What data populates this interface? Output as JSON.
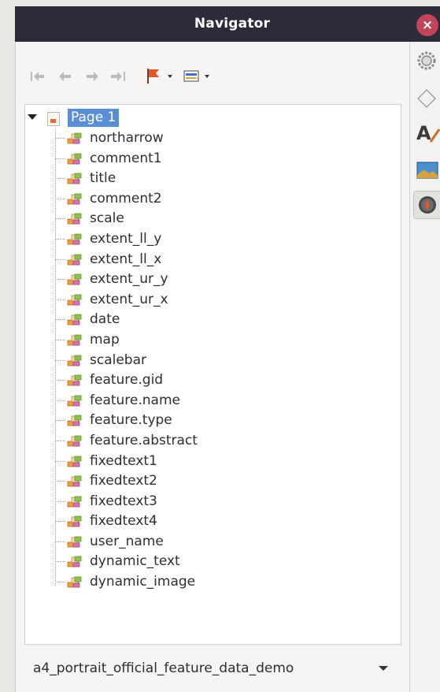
{
  "window": {
    "title": "Navigator",
    "close_label": "×"
  },
  "toolbar": {
    "buttons": [
      {
        "icon": "first-page-icon"
      },
      {
        "icon": "previous-page-icon"
      },
      {
        "icon": "next-page-icon"
      },
      {
        "icon": "last-page-icon"
      },
      {
        "icon": "flag-dropdown-icon"
      },
      {
        "icon": "display-mode-dropdown-icon"
      }
    ]
  },
  "tree": {
    "root_label": "Page 1",
    "items": [
      "northarrow",
      "comment1",
      "title",
      "comment2",
      "scale",
      "extent_ll_y",
      "extent_ll_x",
      "extent_ur_y",
      "extent_ur_x",
      "date",
      "map",
      "scalebar",
      "feature.gid",
      "feature.name",
      "feature.type",
      "feature.abstract",
      "fixedtext1",
      "fixedtext2",
      "fixedtext3",
      "fixedtext4",
      "user_name",
      "dynamic_text",
      "dynamic_image"
    ]
  },
  "document_select": {
    "selected": "a4_portrait_official_feature_data_demo"
  },
  "sidebar": {
    "buttons": [
      {
        "icon": "properties-gear-icon"
      },
      {
        "icon": "styles-diamond-icon"
      },
      {
        "icon": "fontwork-icon"
      },
      {
        "icon": "gallery-icon"
      },
      {
        "icon": "navigator-compass-icon",
        "active": true
      }
    ]
  },
  "colors": {
    "titlebar": "#2d2b39",
    "close_button": "#c2445a",
    "selection": "#5a8fd6"
  }
}
